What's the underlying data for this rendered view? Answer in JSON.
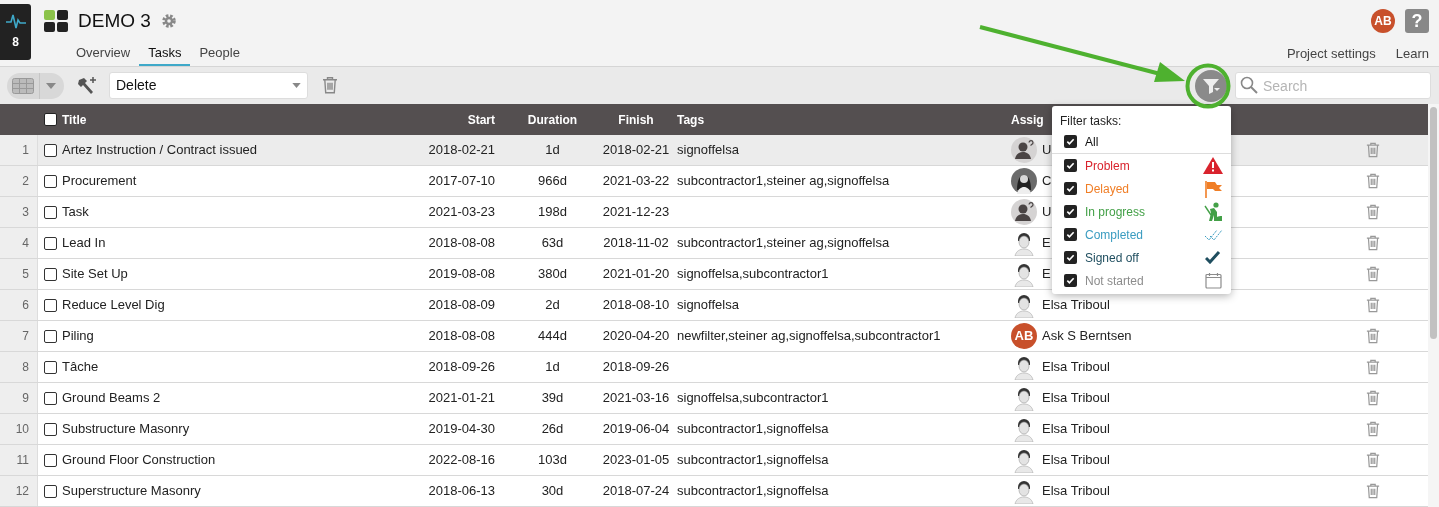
{
  "app": {
    "badge": "8"
  },
  "project": {
    "title": "DEMO 3"
  },
  "tabs": [
    {
      "label": "Overview",
      "selected": false
    },
    {
      "label": "Tasks",
      "selected": true
    },
    {
      "label": "People",
      "selected": false
    }
  ],
  "user": {
    "initials": "AB"
  },
  "help": {
    "label": "?"
  },
  "links": [
    "Project settings",
    "Learn"
  ],
  "toolbar": {
    "action": "Delete",
    "search_placeholder": "Search"
  },
  "columns": {
    "all_checked": false,
    "title": "Title",
    "start": "Start",
    "duration": "Duration",
    "finish": "Finish",
    "tags": "Tags",
    "assignee": "Assig"
  },
  "rows": [
    {
      "number": "1",
      "title": "Artez Instruction / Contract issued",
      "start": "2018-02-21",
      "duration": "1d",
      "finish": "2018-02-21",
      "tags": "signoffelsa",
      "assignee": "U",
      "kind": "unknown",
      "selected": true,
      "checked": false
    },
    {
      "number": "2",
      "title": "Procurement",
      "start": "2017-07-10",
      "duration": "966d",
      "finish": "2021-03-22",
      "tags": "subcontractor1,steiner ag,signoffelsa",
      "assignee": "C",
      "kind": "photo",
      "selected": false,
      "checked": false
    },
    {
      "number": "3",
      "title": "Task",
      "start": "2021-03-23",
      "duration": "198d",
      "finish": "2021-12-23",
      "tags": "",
      "assignee": "U",
      "kind": "unknown",
      "selected": false,
      "checked": false
    },
    {
      "number": "4",
      "title": "Lead In",
      "start": "2018-08-08",
      "duration": "63d",
      "finish": "2018-11-02",
      "tags": "subcontractor1,steiner ag,signoffelsa",
      "assignee": "E",
      "kind": "person",
      "selected": false,
      "checked": false
    },
    {
      "number": "5",
      "title": "Site Set Up",
      "start": "2019-08-08",
      "duration": "380d",
      "finish": "2021-01-20",
      "tags": "signoffelsa,subcontractor1",
      "assignee": "E",
      "kind": "person",
      "selected": false,
      "checked": false
    },
    {
      "number": "6",
      "title": "Reduce Level Dig",
      "start": "2018-08-09",
      "duration": "2d",
      "finish": "2018-08-10",
      "tags": "signoffelsa",
      "assignee": "Elsa Triboul",
      "kind": "person",
      "selected": false,
      "checked": false
    },
    {
      "number": "7",
      "title": "Piling",
      "start": "2018-08-08",
      "duration": "444d",
      "finish": "2020-04-20",
      "tags": "newfilter,steiner ag,signoffelsa,subcontractor1",
      "assignee": "Ask S Berntsen",
      "kind": "initials",
      "initials": "AB",
      "selected": false,
      "checked": false
    },
    {
      "number": "8",
      "title": "Tâche",
      "start": "2018-09-26",
      "duration": "1d",
      "finish": "2018-09-26",
      "tags": "",
      "assignee": "Elsa Triboul",
      "kind": "person",
      "selected": false,
      "checked": false
    },
    {
      "number": "9",
      "title": "Ground Beams 2",
      "start": "2021-01-21",
      "duration": "39d",
      "finish": "2021-03-16",
      "tags": "signoffelsa,subcontractor1",
      "assignee": "Elsa Triboul",
      "kind": "person",
      "selected": false,
      "checked": false
    },
    {
      "number": "10",
      "title": "Substructure Masonry",
      "start": "2019-04-30",
      "duration": "26d",
      "finish": "2019-06-04",
      "tags": "subcontractor1,signoffelsa",
      "assignee": "Elsa Triboul",
      "kind": "person",
      "selected": false,
      "checked": false
    },
    {
      "number": "11",
      "title": "Ground Floor Construction",
      "start": "2022-08-16",
      "duration": "103d",
      "finish": "2023-01-05",
      "tags": "subcontractor1,signoffelsa",
      "assignee": "Elsa Triboul",
      "kind": "person",
      "selected": false,
      "checked": false
    },
    {
      "number": "12",
      "title": "Superstructure Masonry",
      "start": "2018-06-13",
      "duration": "30d",
      "finish": "2018-07-24",
      "tags": "subcontractor1,signoffelsa",
      "assignee": "Elsa Triboul",
      "kind": "person",
      "selected": false,
      "checked": false
    }
  ],
  "filter": {
    "heading": "Filter tasks:",
    "all": {
      "label": "All",
      "checked": true
    },
    "options": [
      {
        "label": "Problem",
        "checked": true,
        "color": "#d9232d",
        "kind": "problem"
      },
      {
        "label": "Delayed",
        "checked": true,
        "color": "#f07e26",
        "kind": "delayed"
      },
      {
        "label": "In progress",
        "checked": true,
        "color": "#43a047",
        "kind": "progress"
      },
      {
        "label": "Completed",
        "checked": true,
        "color": "#3a9cc0",
        "kind": "completed"
      },
      {
        "label": "Signed off",
        "checked": true,
        "color": "#1f4e5f",
        "kind": "signed"
      },
      {
        "label": "Not started",
        "checked": true,
        "color": "#8c8c8c",
        "kind": "notstarted"
      }
    ]
  }
}
